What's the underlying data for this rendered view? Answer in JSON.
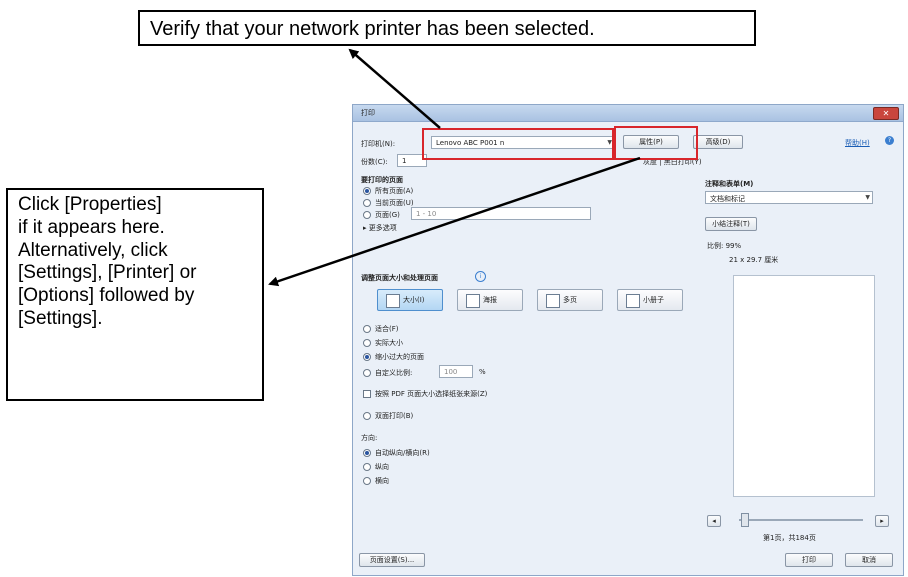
{
  "callouts": {
    "top": "Verify that your network printer has been selected.",
    "left": [
      "Click [Properties]",
      "if it appears here.",
      "Alternatively, click",
      "[Settings], [Printer] or",
      "[Options] followed by",
      "[Settings]."
    ]
  },
  "dialog": {
    "title": "打印",
    "printer_label": "打印机(N):",
    "printer_value": "Lenovo ABC P001 n",
    "properties_button": "属性(P)",
    "advanced_button": "高级(D)",
    "help_link": "帮助(H)",
    "copies_label": "份数(C):",
    "copies_value": "1",
    "print_status": "灰度 | 黑白打印(Y)",
    "pages_section": "要打印的页面",
    "pages_options": [
      "所有页面(A)",
      "当前页面(U)",
      "页面(G)"
    ],
    "pages_range": "1 - 10",
    "more_options": "▸ 更多选项",
    "sizing_section": "调整页面大小和处理页面",
    "sizing_tiles": [
      "大小(I)",
      "海报",
      "多页",
      "小册子"
    ],
    "sizing_options": [
      "适合(F)",
      "实际大小",
      "缩小过大的页面",
      "自定义比例:"
    ],
    "custom_scale_value": "100",
    "custom_scale_unit": "%",
    "pdf_paper_option": "按照 PDF 页面大小选择纸张来源(Z)",
    "two_sided": "双面打印(B)",
    "orientation_label": "方向:",
    "orientation_options": [
      "自动纵向/横向(R)",
      "纵向",
      "横向"
    ],
    "comments_label": "注释和表单(M)",
    "comments_value": "文档和标记",
    "summarize_button": "小结注释(T)",
    "scale_text": "比例: 99%",
    "paper_size_text": "21 x 29.7 厘米",
    "page_counter": "第1页，共184页",
    "page_setup_button": "页面设置(S)...",
    "print_button": "打印",
    "cancel_button": "取消"
  }
}
